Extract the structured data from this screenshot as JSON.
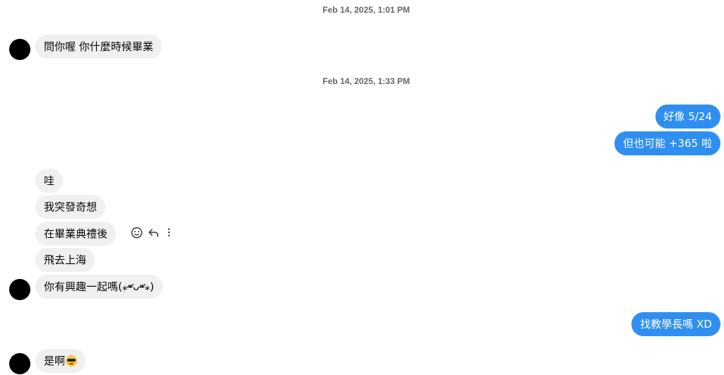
{
  "thread": {
    "timestamps": [
      "Feb 14, 2025, 1:01 PM",
      "Feb 14, 2025, 1:33 PM"
    ],
    "messages": [
      {
        "text": "問你喔 你什麼時候畢業",
        "direction": "incoming"
      },
      {
        "text": "好像 5/24",
        "direction": "outgoing"
      },
      {
        "text": "但也可能 +365 啦",
        "direction": "outgoing"
      },
      {
        "text": "哇",
        "direction": "incoming"
      },
      {
        "text": "我突發奇想",
        "direction": "incoming"
      },
      {
        "text": "在畢業典禮後",
        "direction": "incoming"
      },
      {
        "text": "飛去上海",
        "direction": "incoming"
      },
      {
        "text": "你有興趣一起嗎(⁎⁍̴̛ᴗ⁍̴̛⁎)",
        "direction": "incoming"
      },
      {
        "text": "找教學長嗎 XD",
        "direction": "outgoing"
      },
      {
        "text": "是啊",
        "direction": "incoming",
        "emoji": "smiling-face-with-sunglasses"
      }
    ]
  },
  "hover_actions": {
    "icons": [
      "react-smiley-icon",
      "reply-icon",
      "more-options-icon"
    ]
  },
  "colors": {
    "incoming_bubble": "#f0f0f0",
    "outgoing_bubble": "#2f8ff0",
    "timestamp_text": "#65676b"
  }
}
